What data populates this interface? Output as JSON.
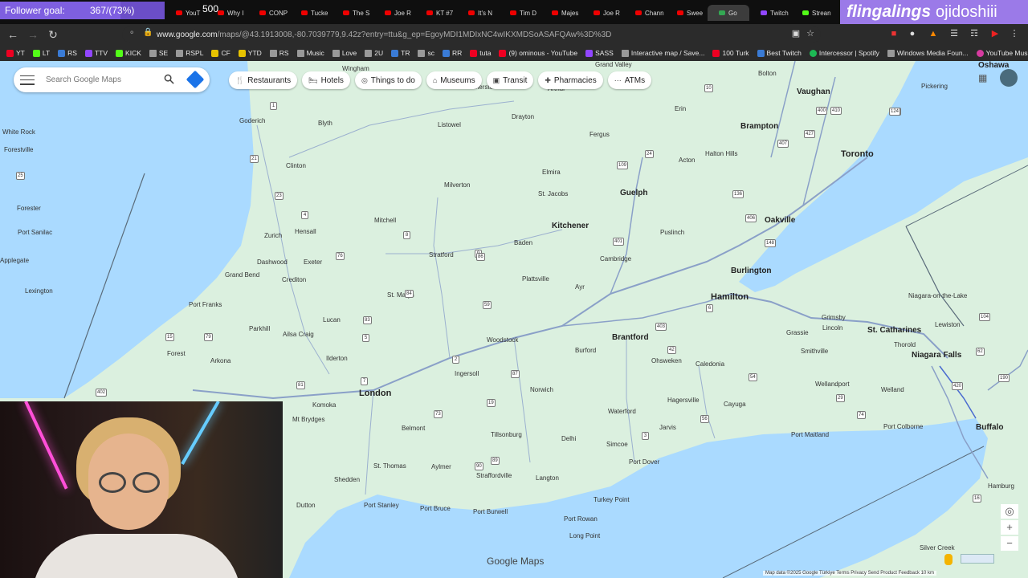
{
  "stream_overlay": {
    "goal_label": "Follower goal:",
    "goal_value": "367/(73%)",
    "goal_progress": 0.73,
    "badge_500": "500",
    "streamer_name": "flingalings",
    "streamer_handle": "ojidoshiii"
  },
  "tabs": [
    {
      "label": "YouT",
      "icon": "youtube-icon"
    },
    {
      "label": "Why I",
      "icon": "youtube-icon"
    },
    {
      "label": "CONP",
      "icon": "youtube-icon"
    },
    {
      "label": "Tucke",
      "icon": "youtube-icon"
    },
    {
      "label": "The S",
      "icon": "youtube-icon"
    },
    {
      "label": "Joe R",
      "icon": "youtube-icon"
    },
    {
      "label": "KT #7",
      "icon": "youtube-icon"
    },
    {
      "label": "It's N",
      "icon": "youtube-icon"
    },
    {
      "label": "Tim D",
      "icon": "youtube-icon"
    },
    {
      "label": "Majes",
      "icon": "youtube-icon"
    },
    {
      "label": "Joe R",
      "icon": "youtube-icon"
    },
    {
      "label": "Chann",
      "icon": "youtube-icon"
    },
    {
      "label": "Swee",
      "icon": "youtube-icon"
    },
    {
      "label": "Go",
      "icon": "google-maps-icon",
      "active": true
    },
    {
      "label": "Twitch",
      "icon": "twitch-icon"
    },
    {
      "label": "Strean",
      "icon": "kick-icon"
    }
  ],
  "browser": {
    "url_prefix": "www.google.com",
    "url_rest": "/maps/@43.1913008,-80.7039779,9.42z?entry=ttu&g_ep=EgoyMDI1MDIxNC4wIKXMDSoASAFQAw%3D%3D"
  },
  "bookmarks": [
    {
      "label": "YT",
      "icon": "youtube-icon"
    },
    {
      "label": "LT",
      "icon": "leaf-icon"
    },
    {
      "label": "RS",
      "icon": "rs-icon"
    },
    {
      "label": "TTV",
      "icon": "twitch-icon"
    },
    {
      "label": "KICK",
      "icon": "kick-icon"
    },
    {
      "label": "SE",
      "icon": "se-icon"
    },
    {
      "label": "RSPL",
      "icon": "rspl-icon"
    },
    {
      "label": "CF",
      "icon": "cf-icon"
    },
    {
      "label": "YTD",
      "icon": "ytd-icon"
    },
    {
      "label": "RS",
      "icon": "folder-icon"
    },
    {
      "label": "Music",
      "icon": "folder-icon"
    },
    {
      "label": "Love",
      "icon": "folder-icon"
    },
    {
      "label": "2U",
      "icon": "folder-icon"
    },
    {
      "label": "TR",
      "icon": "tr-icon"
    },
    {
      "label": "sc",
      "icon": "sc-icon"
    },
    {
      "label": "RR",
      "icon": "rr-icon"
    },
    {
      "label": "tuta",
      "icon": "tuta-icon"
    },
    {
      "label": "(9) ominous - YouTube",
      "icon": "youtube-icon"
    },
    {
      "label": "SASS",
      "icon": "sass-icon"
    },
    {
      "label": "Interactive map / Save...",
      "icon": "map-icon"
    },
    {
      "label": "100 Turk",
      "icon": "youtube-icon"
    },
    {
      "label": "Best Twitch",
      "icon": "h-icon"
    },
    {
      "label": "Intercessor | Spotify",
      "icon": "spotify-icon"
    },
    {
      "label": "Windows Media Foun...",
      "icon": "github-icon"
    },
    {
      "label": "YouTube Music",
      "icon": "youtube-music-icon"
    }
  ],
  "maps": {
    "search_placeholder": "Search Google Maps",
    "chips": [
      {
        "label": "Restaurants",
        "icon": "fork-knife-icon",
        "glyph": "🍴"
      },
      {
        "label": "Hotels",
        "icon": "bed-icon",
        "glyph": "🛏"
      },
      {
        "label": "Things to do",
        "icon": "camera-icon",
        "glyph": "◎"
      },
      {
        "label": "Museums",
        "icon": "museum-icon",
        "glyph": "⌂"
      },
      {
        "label": "Transit",
        "icon": "train-icon",
        "glyph": "▣"
      },
      {
        "label": "Pharmacies",
        "icon": "pharmacy-icon",
        "glyph": "✚"
      },
      {
        "label": "ATMs",
        "icon": "atm-icon",
        "glyph": "⋯"
      }
    ],
    "logo": "Google Maps",
    "attribution": "Map data ©2025 Google   Türkiye   Terms   Privacy   Send Product Feedback   10 km",
    "water_color": "#aadaff",
    "land_color": "#dbf0df"
  },
  "places": [
    {
      "name": "Toronto",
      "type": "big"
    },
    {
      "name": "Hamilton",
      "type": "big"
    },
    {
      "name": "London",
      "type": "big"
    },
    {
      "name": "Kitchener",
      "type": "city"
    },
    {
      "name": "Guelph",
      "type": "city"
    },
    {
      "name": "Brampton",
      "type": "city"
    },
    {
      "name": "Vaughan",
      "type": "city"
    },
    {
      "name": "Oakville",
      "type": "city"
    },
    {
      "name": "Burlington",
      "type": "city"
    },
    {
      "name": "Brantford",
      "type": "city"
    },
    {
      "name": "St. Catharines",
      "type": "city"
    },
    {
      "name": "Niagara Falls",
      "type": "city"
    },
    {
      "name": "Buffalo",
      "type": "city"
    },
    {
      "name": "Oshawa",
      "type": "city"
    },
    {
      "name": "Cambridge",
      "type": "town"
    },
    {
      "name": "Woodstock",
      "type": "town"
    },
    {
      "name": "Stratford",
      "type": "town"
    },
    {
      "name": "St. Marys",
      "type": "town"
    },
    {
      "name": "Ingersoll",
      "type": "town"
    },
    {
      "name": "Tillsonburg",
      "type": "town"
    },
    {
      "name": "Simcoe",
      "type": "town"
    },
    {
      "name": "St. Thomas",
      "type": "town"
    },
    {
      "name": "Milverton",
      "type": "town"
    },
    {
      "name": "Mitchell",
      "type": "town"
    },
    {
      "name": "Listowel",
      "type": "town"
    },
    {
      "name": "Elmira",
      "type": "town"
    },
    {
      "name": "St. Jacobs",
      "type": "town"
    },
    {
      "name": "Baden",
      "type": "town"
    },
    {
      "name": "Plattsville",
      "type": "town"
    },
    {
      "name": "Ayr",
      "type": "town"
    },
    {
      "name": "Puslinch",
      "type": "town"
    },
    {
      "name": "Fergus",
      "type": "town"
    },
    {
      "name": "Acton",
      "type": "town"
    },
    {
      "name": "Erin",
      "type": "town"
    },
    {
      "name": "Halton Hills",
      "type": "town"
    },
    {
      "name": "Bolton",
      "type": "town"
    },
    {
      "name": "Pickering",
      "type": "town"
    },
    {
      "name": "Drayton",
      "type": "town"
    },
    {
      "name": "Arthur",
      "type": "town"
    },
    {
      "name": "Palmerston",
      "type": "town"
    },
    {
      "name": "Grand Valley",
      "type": "town"
    },
    {
      "name": "Wingham",
      "type": "town"
    },
    {
      "name": "Blyth",
      "type": "town"
    },
    {
      "name": "Goderich",
      "type": "town"
    },
    {
      "name": "Clinton",
      "type": "town"
    },
    {
      "name": "Zurich",
      "type": "town"
    },
    {
      "name": "Hensall",
      "type": "town"
    },
    {
      "name": "Exeter",
      "type": "town"
    },
    {
      "name": "Dashwood",
      "type": "town"
    },
    {
      "name": "Crediton",
      "type": "town"
    },
    {
      "name": "Grand Bend",
      "type": "town"
    },
    {
      "name": "Port Franks",
      "type": "town"
    },
    {
      "name": "Parkhill",
      "type": "town"
    },
    {
      "name": "Ailsa Craig",
      "type": "town"
    },
    {
      "name": "Lucan",
      "type": "town"
    },
    {
      "name": "Ilderton",
      "type": "town"
    },
    {
      "name": "Forest",
      "type": "town"
    },
    {
      "name": "Arkona",
      "type": "town"
    },
    {
      "name": "Komoka",
      "type": "town"
    },
    {
      "name": "Mt Brydges",
      "type": "town"
    },
    {
      "name": "Belmont",
      "type": "town"
    },
    {
      "name": "Aylmer",
      "type": "town"
    },
    {
      "name": "Straffordville",
      "type": "town"
    },
    {
      "name": "Langton",
      "type": "town"
    },
    {
      "name": "Delhi",
      "type": "town"
    },
    {
      "name": "Norwich",
      "type": "town"
    },
    {
      "name": "Burford",
      "type": "town"
    },
    {
      "name": "Waterford",
      "type": "town"
    },
    {
      "name": "Ohsweken",
      "type": "town"
    },
    {
      "name": "Caledonia",
      "type": "town"
    },
    {
      "name": "Hagersville",
      "type": "town"
    },
    {
      "name": "Jarvis",
      "type": "town"
    },
    {
      "name": "Cayuga",
      "type": "town"
    },
    {
      "name": "Port Dover",
      "type": "town"
    },
    {
      "name": "Turkey Point",
      "type": "town"
    },
    {
      "name": "Port Rowan",
      "type": "town"
    },
    {
      "name": "Long Point",
      "type": "town"
    },
    {
      "name": "Port Burwell",
      "type": "town"
    },
    {
      "name": "Port Bruce",
      "type": "town"
    },
    {
      "name": "Port Stanley",
      "type": "town"
    },
    {
      "name": "Shedden",
      "type": "town"
    },
    {
      "name": "Dutton",
      "type": "town"
    },
    {
      "name": "Grimsby",
      "type": "town"
    },
    {
      "name": "Lincoln",
      "type": "town"
    },
    {
      "name": "Grassie",
      "type": "town"
    },
    {
      "name": "Smithville",
      "type": "town"
    },
    {
      "name": "Thorold",
      "type": "town"
    },
    {
      "name": "Welland",
      "type": "town"
    },
    {
      "name": "Wellandport",
      "type": "town"
    },
    {
      "name": "Port Colborne",
      "type": "town"
    },
    {
      "name": "Port Maitland",
      "type": "town"
    },
    {
      "name": "Niagara-on-the-Lake",
      "type": "town"
    },
    {
      "name": "Lewiston",
      "type": "town"
    },
    {
      "name": "Hamburg",
      "type": "town"
    },
    {
      "name": "Silver Creek",
      "type": "town"
    },
    {
      "name": "White Rock",
      "type": "town"
    },
    {
      "name": "Forestville",
      "type": "town"
    },
    {
      "name": "Forester",
      "type": "town"
    },
    {
      "name": "Port Sanilac",
      "type": "town"
    },
    {
      "name": "Applegate",
      "type": "town"
    },
    {
      "name": "Lexington",
      "type": "town"
    }
  ],
  "route_shields": [
    "1",
    "21",
    "23",
    "4",
    "7",
    "8",
    "9",
    "6",
    "24",
    "401",
    "403",
    "402",
    "410",
    "427",
    "400",
    "407",
    "19",
    "3",
    "59",
    "2",
    "5",
    "25",
    "10",
    "62",
    "104",
    "190",
    "20",
    "29",
    "42",
    "54",
    "56",
    "73",
    "74",
    "76",
    "79",
    "81",
    "83",
    "84",
    "86",
    "87",
    "89",
    "90",
    "109",
    "124",
    "136",
    "148",
    "406",
    "420",
    "15",
    "13",
    "16"
  ]
}
